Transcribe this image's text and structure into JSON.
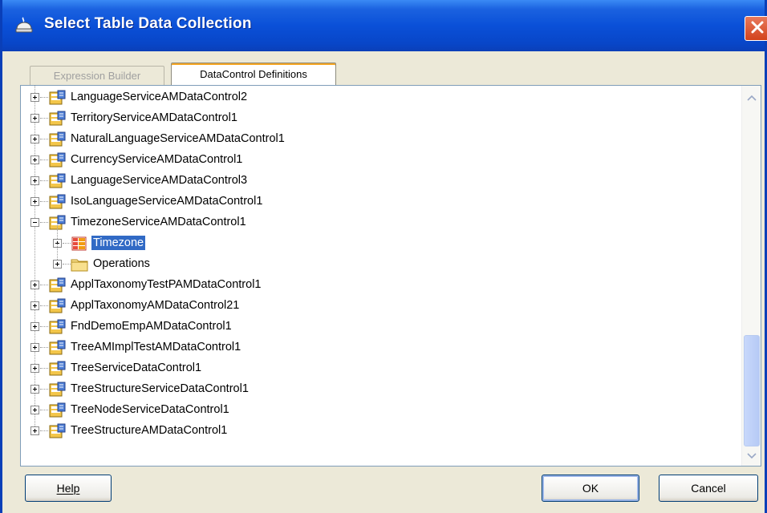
{
  "window": {
    "title": "Select Table Data Collection"
  },
  "tabs": [
    {
      "label": "Expression Builder",
      "active": false
    },
    {
      "label": "DataControl Definitions",
      "active": true
    }
  ],
  "tree": {
    "items": [
      {
        "label": "LanguageServiceAMDataControl2",
        "level": 0,
        "icon": "datacontrol-icon",
        "expanded": false
      },
      {
        "label": "TerritoryServiceAMDataControl1",
        "level": 0,
        "icon": "datacontrol-icon",
        "expanded": false
      },
      {
        "label": "NaturalLanguageServiceAMDataControl1",
        "level": 0,
        "icon": "datacontrol-icon",
        "expanded": false
      },
      {
        "label": "CurrencyServiceAMDataControl1",
        "level": 0,
        "icon": "datacontrol-icon",
        "expanded": false
      },
      {
        "label": "LanguageServiceAMDataControl3",
        "level": 0,
        "icon": "datacontrol-icon",
        "expanded": false
      },
      {
        "label": "IsoLanguageServiceAMDataControl1",
        "level": 0,
        "icon": "datacontrol-icon",
        "expanded": false
      },
      {
        "label": "TimezoneServiceAMDataControl1",
        "level": 0,
        "icon": "datacontrol-icon",
        "expanded": true
      },
      {
        "label": "Timezone",
        "level": 1,
        "icon": "collection-icon",
        "expanded": false,
        "selected": true
      },
      {
        "label": "Operations",
        "level": 1,
        "icon": "folder-icon",
        "expanded": false
      },
      {
        "label": "ApplTaxonomyTestPAMDataControl1",
        "level": 0,
        "icon": "datacontrol-icon",
        "expanded": false
      },
      {
        "label": "ApplTaxonomyAMDataControl21",
        "level": 0,
        "icon": "datacontrol-icon",
        "expanded": false
      },
      {
        "label": "FndDemoEmpAMDataControl1",
        "level": 0,
        "icon": "datacontrol-icon",
        "expanded": false
      },
      {
        "label": "TreeAMImplTestAMDataControl1",
        "level": 0,
        "icon": "datacontrol-icon",
        "expanded": false
      },
      {
        "label": "TreeServiceDataControl1",
        "level": 0,
        "icon": "datacontrol-icon",
        "expanded": false
      },
      {
        "label": "TreeStructureServiceDataControl1",
        "level": 0,
        "icon": "datacontrol-icon",
        "expanded": false
      },
      {
        "label": "TreeNodeServiceDataControl1",
        "level": 0,
        "icon": "datacontrol-icon",
        "expanded": false
      },
      {
        "label": "TreeStructureAMDataControl1",
        "level": 0,
        "icon": "datacontrol-icon",
        "expanded": false
      }
    ]
  },
  "buttons": {
    "help": "Help",
    "ok": "OK",
    "cancel": "Cancel"
  },
  "colors": {
    "titlebar": "#0a50d8",
    "selection": "#316ac5",
    "close": "#d2431d"
  }
}
